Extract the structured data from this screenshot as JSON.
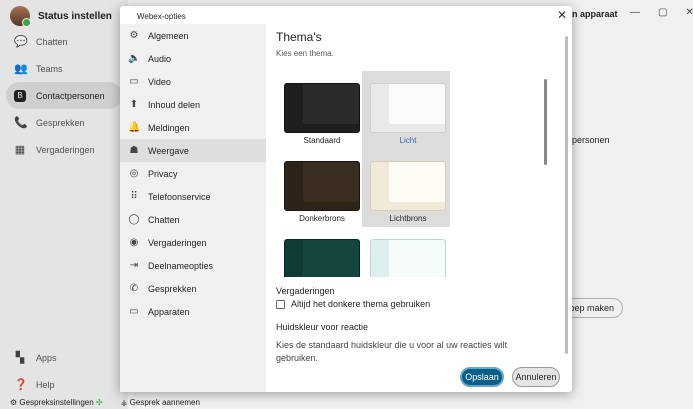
{
  "app": {
    "status_label": "Status instellen",
    "window_title": "n apparaat",
    "bg_personen": "personen",
    "bg_pill": "oep maken",
    "nav": [
      {
        "label": "Chatten",
        "icon": "chat-bubble-icon"
      },
      {
        "label": "Teams",
        "icon": "people-icon"
      },
      {
        "label": "Contactpersonen",
        "icon": "contacts-icon",
        "active": true
      },
      {
        "label": "Gesprekken",
        "icon": "phone-icon"
      },
      {
        "label": "Vergaderingen",
        "icon": "calendar-icon"
      }
    ],
    "bottom_nav": [
      {
        "label": "Apps",
        "icon": "apps-icon"
      },
      {
        "label": "Help",
        "icon": "help-icon"
      }
    ],
    "bottom_bar": {
      "call_settings": "Gespreksinstellingen",
      "accept_call": "Gesprek aannemen"
    }
  },
  "dialog": {
    "title": "Webex-opties",
    "close": "✕",
    "nav": [
      {
        "label": "Algemeen",
        "icon": "gear-icon"
      },
      {
        "label": "Audio",
        "icon": "speaker-icon"
      },
      {
        "label": "Video",
        "icon": "video-icon"
      },
      {
        "label": "Inhoud delen",
        "icon": "share-icon"
      },
      {
        "label": "Meldingen",
        "icon": "bell-icon"
      },
      {
        "label": "Weergave",
        "icon": "display-icon",
        "active": true
      },
      {
        "label": "Privacy",
        "icon": "privacy-icon"
      },
      {
        "label": "Telefoonservice",
        "icon": "dialpad-icon"
      },
      {
        "label": "Chatten",
        "icon": "chat-icon"
      },
      {
        "label": "Vergaderingen",
        "icon": "meetings-icon"
      },
      {
        "label": "Deelnameopties",
        "icon": "join-icon"
      },
      {
        "label": "Gesprekken",
        "icon": "phone-icon"
      },
      {
        "label": "Apparaten",
        "icon": "devices-icon"
      }
    ],
    "section_title": "Thema's",
    "section_subtitle": "Kies een thema.",
    "themes": [
      {
        "name": "Standaard"
      },
      {
        "name": "Licht",
        "selected": true
      },
      {
        "name": "Donkerbrons"
      },
      {
        "name": "Lichtbrons",
        "selected": true
      },
      {
        "name": ""
      },
      {
        "name": ""
      }
    ],
    "meetings_title": "Vergaderingen",
    "dark_theme_checkbox": "Altijd het donkere thema gebruiken",
    "skin_title": "Huidskleur voor reactie",
    "skin_desc": "Kies de standaard huidskleur die u voor al uw reacties wilt gebruiken.",
    "save_label": "Opslaan",
    "cancel_label": "Annuleren"
  }
}
